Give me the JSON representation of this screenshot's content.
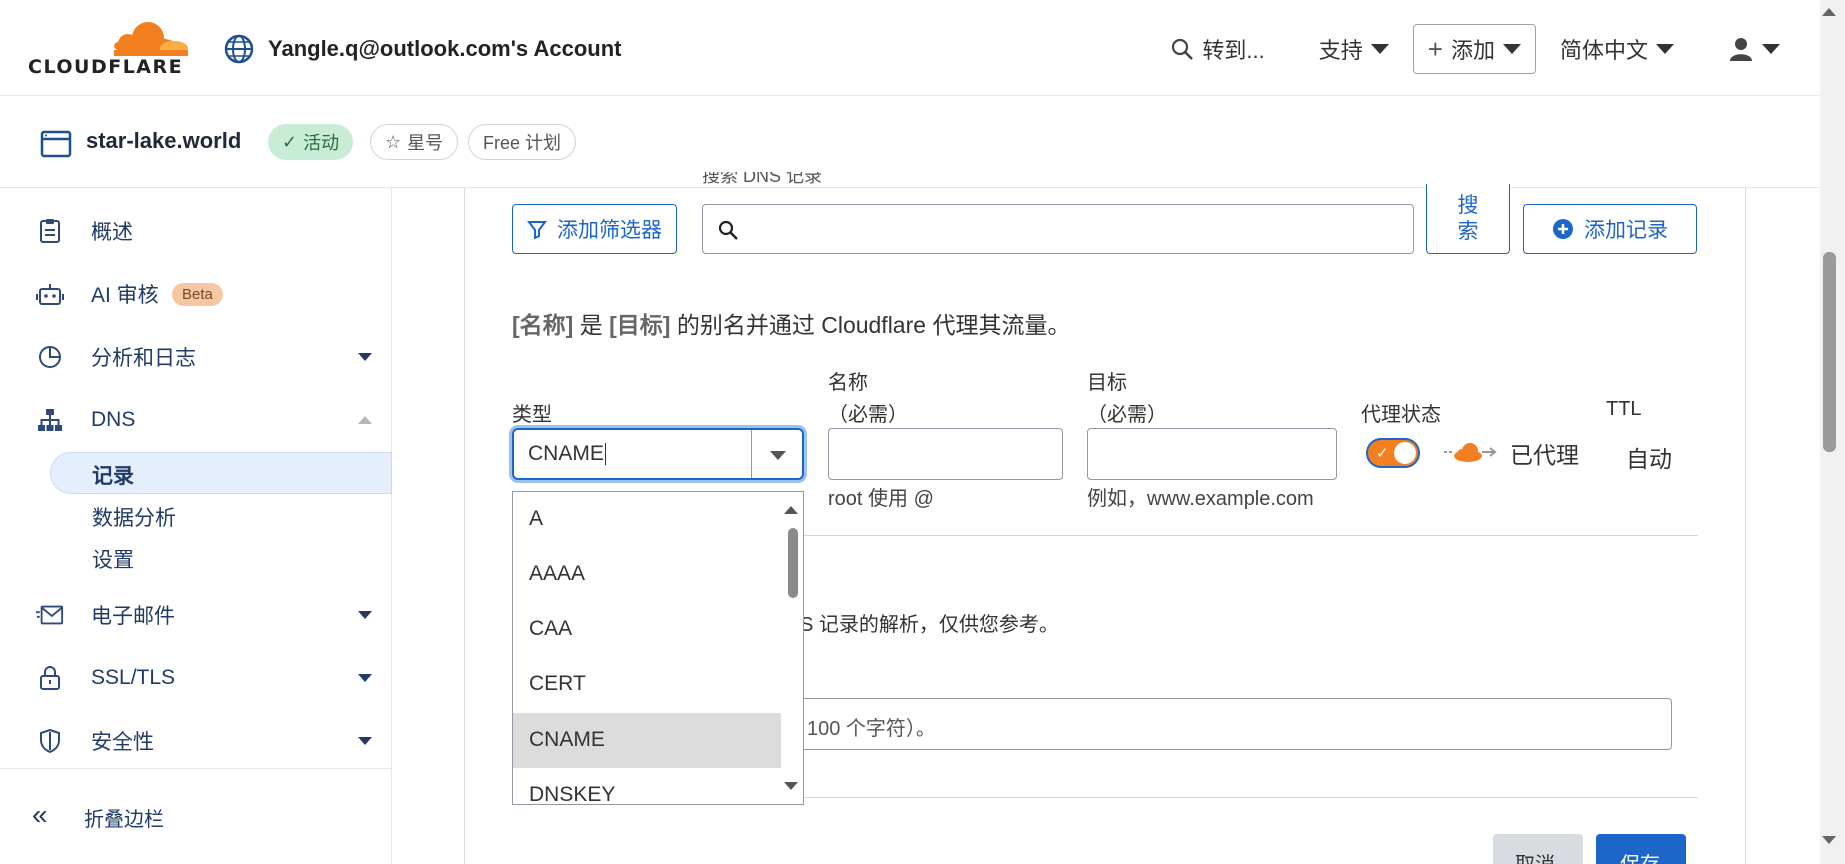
{
  "header": {
    "logo_text": "CLOUDFLARE",
    "account_name": "Yangle.q@outlook.com's Account",
    "goto": "转到...",
    "support": "支持",
    "add": "添加",
    "language": "简体中文",
    "icons": [
      "globe-icon",
      "search-icon",
      "plus-icon",
      "user-icon"
    ]
  },
  "zone": {
    "name": "star-lake.world",
    "status": "活动",
    "star": "星号",
    "plan": "Free 计划"
  },
  "sidebar": {
    "items": [
      {
        "label": "概述",
        "icon": "clipboard-icon"
      },
      {
        "label": "AI 审核",
        "icon": "robot-icon",
        "badge": "Beta"
      },
      {
        "label": "分析和日志",
        "icon": "pie-chart-icon"
      },
      {
        "label": "DNS",
        "icon": "sitemap-icon"
      },
      {
        "label": "电子邮件",
        "icon": "email-icon"
      },
      {
        "label": "SSL/TLS",
        "icon": "lock-icon"
      },
      {
        "label": "安全性",
        "icon": "shield-icon"
      }
    ],
    "dns_sub": [
      "记录",
      "数据分析",
      "设置"
    ],
    "collapse": "折叠边栏"
  },
  "toolbar": {
    "filter": "添加筛选器",
    "search_label": "搜索 DNS 记录",
    "search_btn": "搜索",
    "add_record": "添加记录"
  },
  "form": {
    "desc_name": "[名称]",
    "desc_is": " 是 ",
    "desc_target": "[目标]",
    "desc_rest": " 的别名并通过 Cloudflare 代理其流量。",
    "type_label": "类型",
    "type_value": "CNAME",
    "name_label": "名称",
    "name_required": "（必需）",
    "name_hint": "root 使用 @",
    "target_label": "目标",
    "target_required": "（必需）",
    "target_hint": "例如，www.example.com",
    "proxy_label": "代理状态",
    "proxy_value": "已代理",
    "proxy_on": true,
    "ttl_label": "TTL",
    "ttl_value": "自动",
    "note_partial": "S 记录的解析，仅供您参考。",
    "comment_partial": "100 个字符）。",
    "cancel": "取消",
    "save": "保存"
  },
  "dropdown": {
    "options": [
      "A",
      "AAAA",
      "CAA",
      "CERT",
      "CNAME",
      "DNSKEY"
    ],
    "selected": "CNAME"
  },
  "colors": {
    "accent": "#1d66c9",
    "brand_orange": "#f38020",
    "active_green": "#c9ecd6"
  }
}
